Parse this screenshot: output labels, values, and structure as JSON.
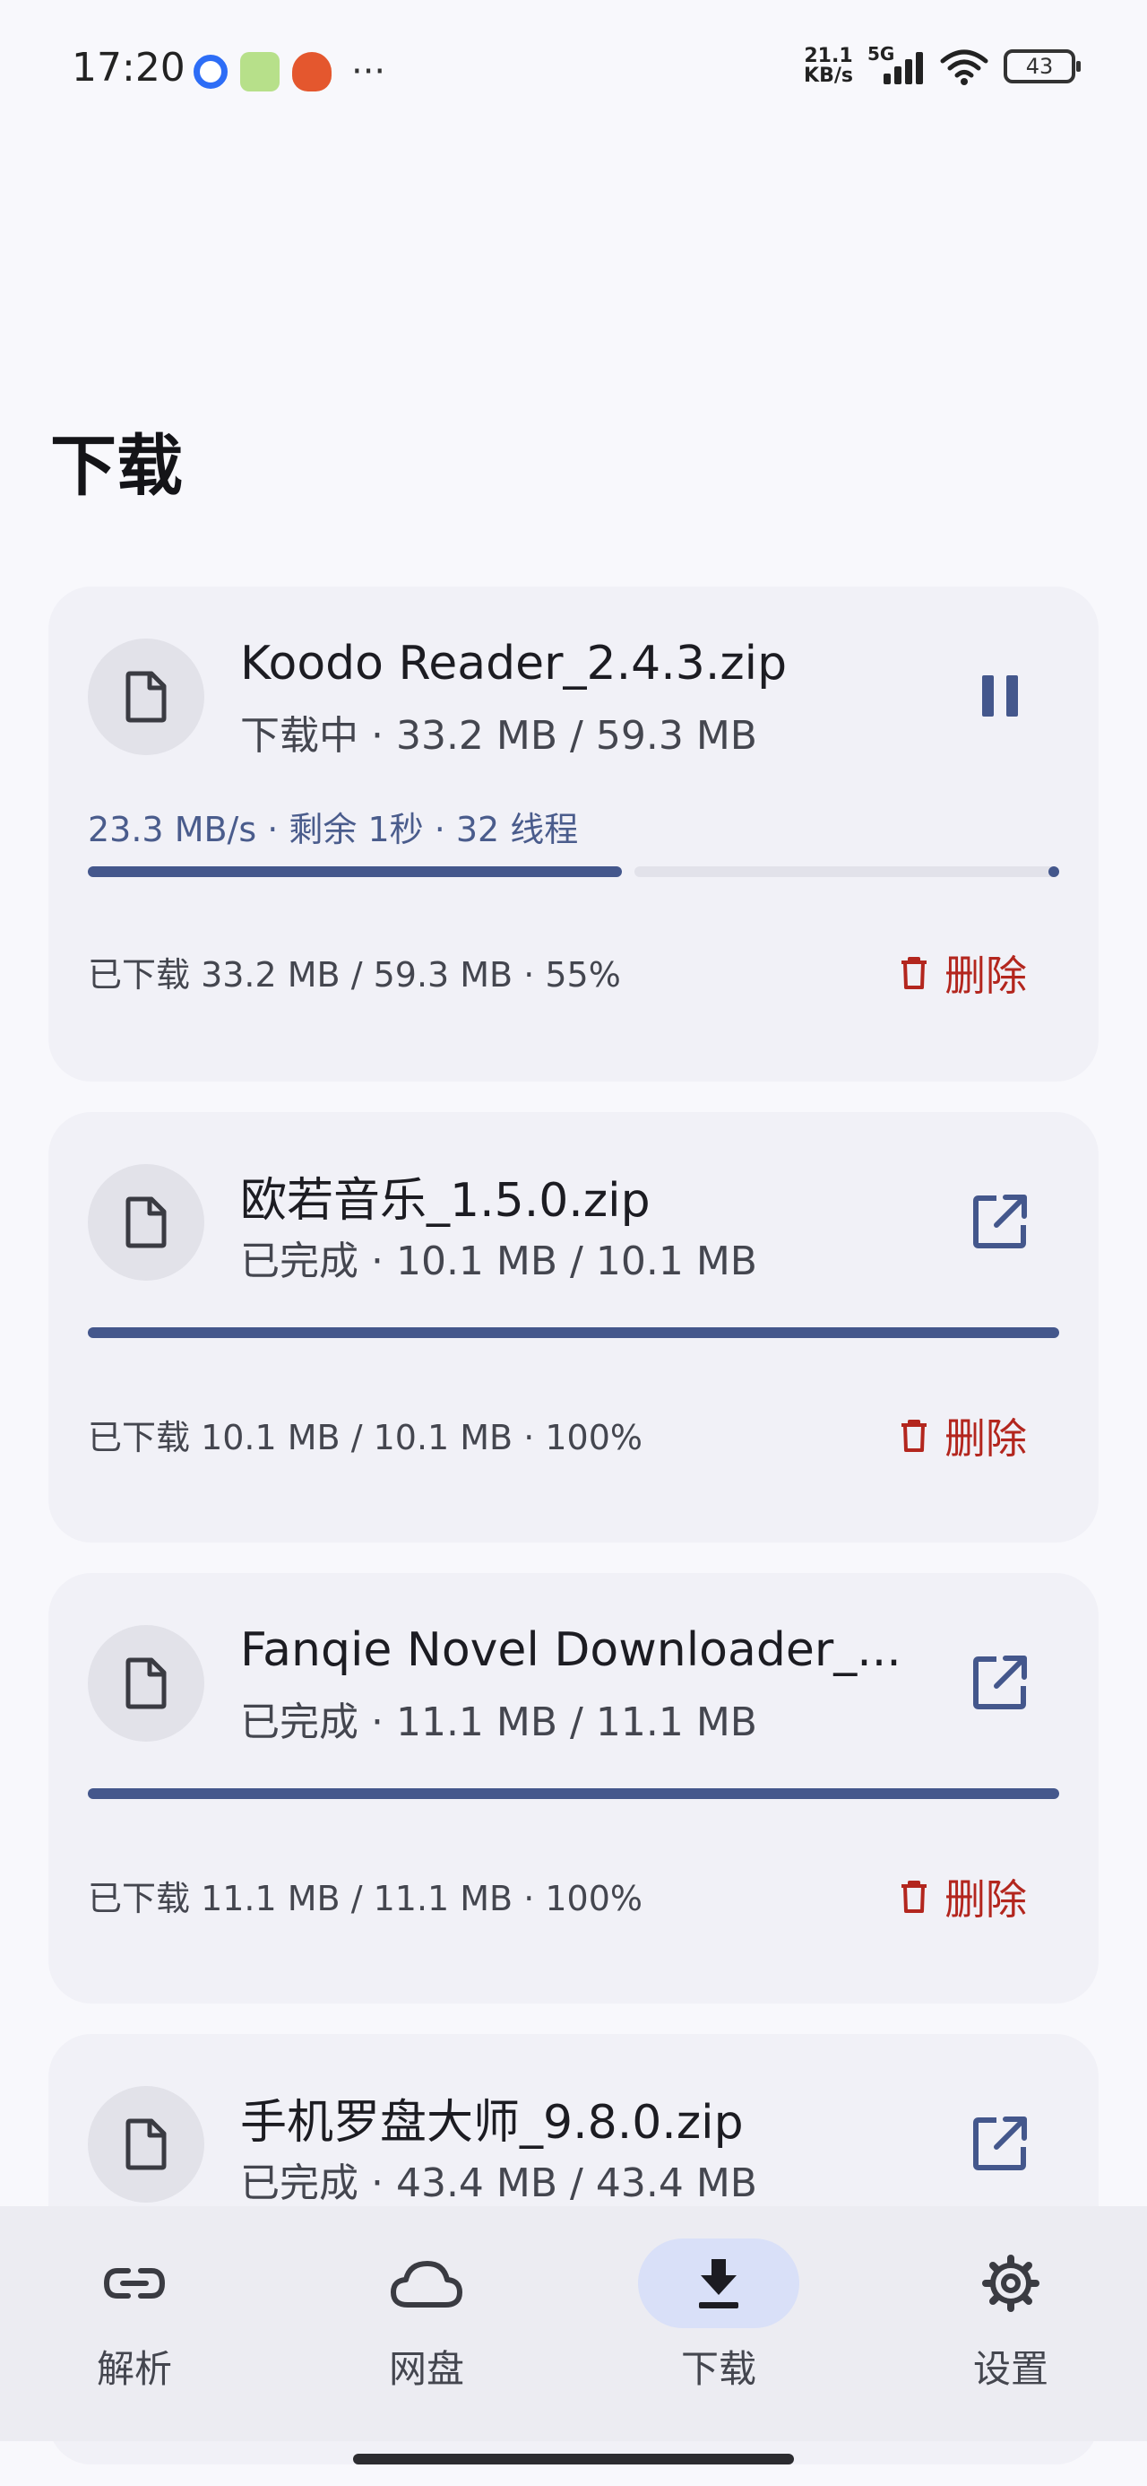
{
  "status_bar": {
    "time": "17:20",
    "net_speed_value": "21.1",
    "net_speed_unit": "KB/s",
    "network": "5G",
    "battery": "43",
    "more": "···",
    "notification_icons": [
      "message-app-icon",
      "feishu-app-icon",
      "tomato-app-icon"
    ]
  },
  "page": {
    "title": "下载"
  },
  "downloads": [
    {
      "name": "Koodo Reader_2.4.3.zip",
      "status": "下载中 · 33.2 MB / 59.3 MB",
      "speed": "23.3 MB/s · 剩余 1秒 · 32 线程",
      "downloaded": "已下载 33.2 MB / 59.3 MB · 55%",
      "progress": 0.55,
      "action_icon": "pause-icon",
      "delete_label": "删除"
    },
    {
      "name": "欧若音乐_1.5.0.zip",
      "status": "已完成 · 10.1 MB / 10.1 MB",
      "downloaded": "已下载 10.1 MB / 10.1 MB · 100%",
      "progress": 1.0,
      "action_icon": "open-external-icon",
      "delete_label": "删除"
    },
    {
      "name": "Fanqie Novel Downloader_...",
      "status": "已完成 · 11.1 MB / 11.1 MB",
      "downloaded": "已下载 11.1 MB / 11.1 MB · 100%",
      "progress": 1.0,
      "action_icon": "open-external-icon",
      "delete_label": "删除"
    },
    {
      "name": "手机罗盘大师_9.8.0.zip",
      "status": "已完成 · 43.4 MB / 43.4 MB",
      "action_icon": "open-external-icon"
    }
  ],
  "nav": {
    "items": [
      {
        "label": "解析",
        "icon": "link-icon",
        "active": false
      },
      {
        "label": "网盘",
        "icon": "cloud-icon",
        "active": false
      },
      {
        "label": "下载",
        "icon": "download-icon",
        "active": true
      },
      {
        "label": "设置",
        "icon": "gear-icon",
        "active": false
      }
    ]
  },
  "colors": {
    "accent": "#44578c",
    "danger": "#b3261e",
    "card_bg": "#f1f1f7",
    "nav_active_pill": "#d9e0f8"
  }
}
